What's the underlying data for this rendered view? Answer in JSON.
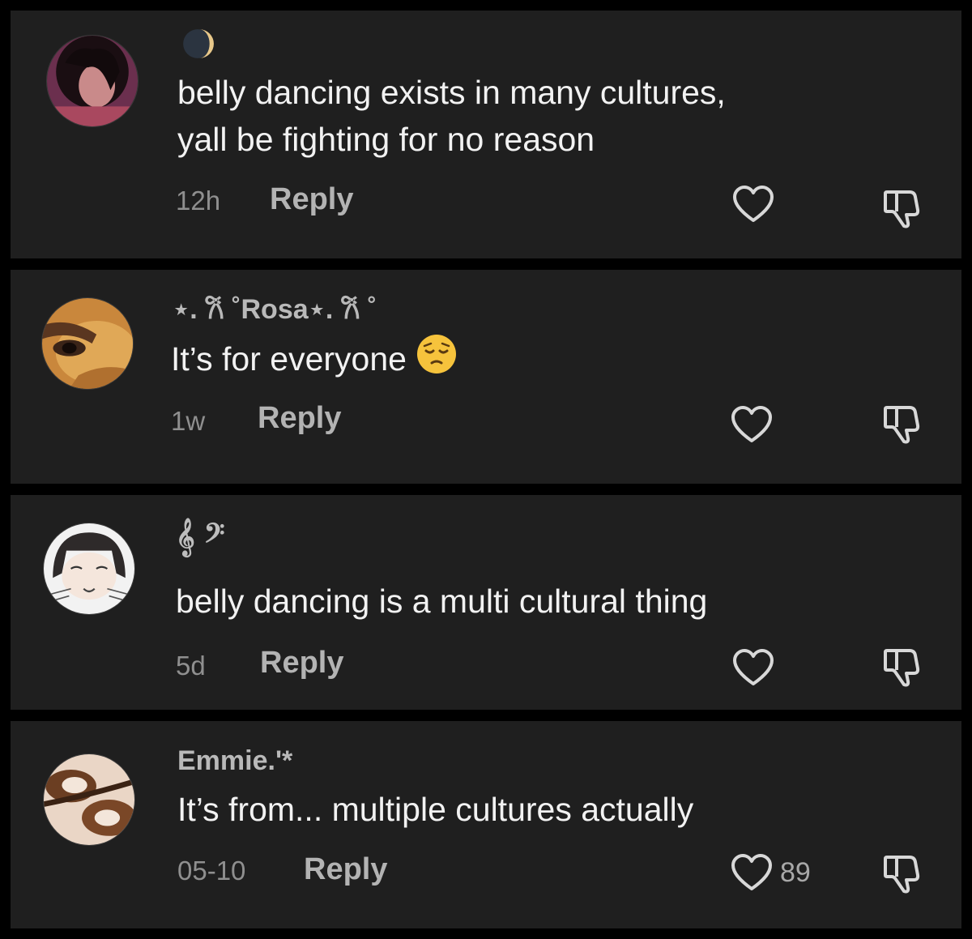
{
  "comments": [
    {
      "username": "",
      "username_icon": "moon-icon",
      "text_line1": "belly dancing exists in many cultures,",
      "text_line2": "yall be fighting for no reason",
      "time": "12h",
      "reply_label": "Reply",
      "like_count": ""
    },
    {
      "username": "⋆. 𐙚 ˚Rosa⋆. 𐙚 ˚",
      "text_line1": "It’s for everyone",
      "emoji": "pensive-face-emoji",
      "time": "1w",
      "reply_label": "Reply",
      "like_count": ""
    },
    {
      "username": "𝄞 𝄢",
      "text_line1": "belly dancing is a multi cultural thing",
      "time": "5d",
      "reply_label": "Reply",
      "like_count": ""
    },
    {
      "username": "Emmie.'*",
      "text_line1": "It’s from... multiple cultures actually",
      "time": "05-10",
      "reply_label": "Reply",
      "like_count": "89"
    }
  ],
  "colors": {
    "background": "#000000",
    "card": "#1f1f1f",
    "text": "#f2f2f2",
    "muted": "#8f8f8f"
  }
}
